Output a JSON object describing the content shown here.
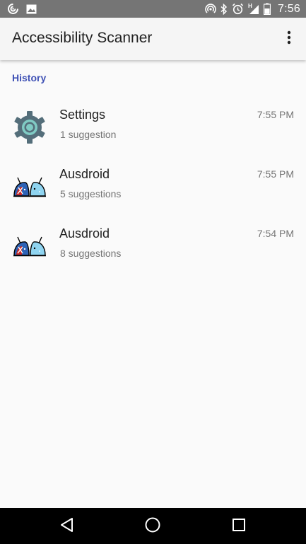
{
  "status_bar": {
    "time": "7:56",
    "icons_left": [
      "data-saver-icon",
      "image-icon"
    ],
    "icons_right": [
      "hotspot-icon",
      "bluetooth-icon",
      "alarm-icon",
      "signal-h-icon",
      "battery-icon"
    ],
    "network_type": "H"
  },
  "app_bar": {
    "title": "Accessibility Scanner",
    "overflow_icon": "more-vert-icon"
  },
  "history": {
    "header": "History",
    "items": [
      {
        "app_name": "Settings",
        "suggestions": "1 suggestion",
        "time": "7:55 PM",
        "icon": "settings-gear-icon"
      },
      {
        "app_name": "Ausdroid",
        "suggestions": "5 suggestions",
        "time": "7:55 PM",
        "icon": "ausdroid-logo-icon"
      },
      {
        "app_name": "Ausdroid",
        "suggestions": "8 suggestions",
        "time": "7:54 PM",
        "icon": "ausdroid-logo-icon"
      }
    ]
  },
  "nav_bar": {
    "buttons": [
      "back-icon",
      "home-icon",
      "recents-icon"
    ]
  },
  "colors": {
    "status_bar": "#757575",
    "app_bar": "#f5f5f5",
    "accent": "#3f51b5",
    "background": "#fafafa",
    "nav_bar": "#000000",
    "settings_gear": "#546e7a",
    "settings_ring": "#80cbc4"
  }
}
